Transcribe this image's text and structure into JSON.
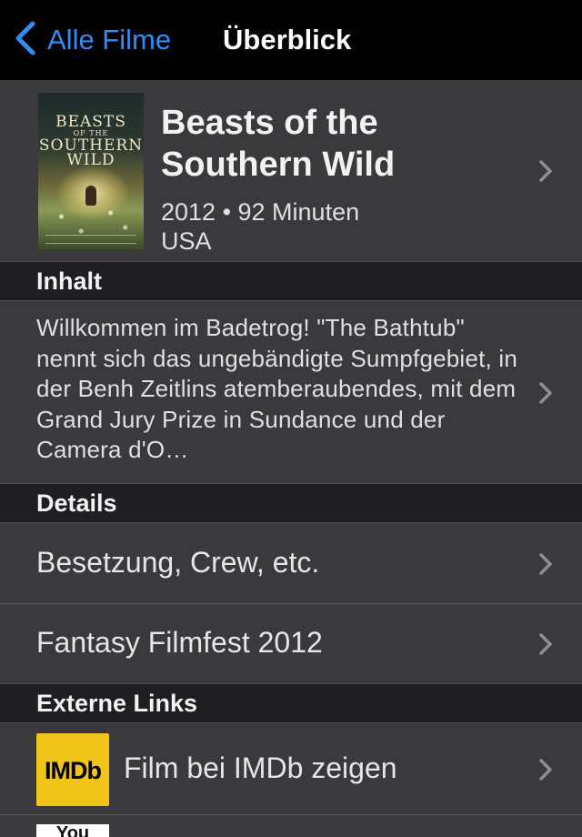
{
  "navbar": {
    "back_label": "Alle Filme",
    "title": "Überblick"
  },
  "movie": {
    "poster_title_line1": "BEASTS",
    "poster_title_small": "OF THE",
    "poster_title_line2": "SOUTHERN",
    "poster_title_line3": "WILD",
    "title": "Beasts of the Southern Wild",
    "year_runtime": "2012 • 92 Minuten",
    "country": "USA"
  },
  "sections": {
    "content": "Inhalt",
    "details": "Details",
    "external_links": "Externe Links"
  },
  "synopsis": "Willkommen im Badetrog! \"The Bathtub\" nennt sich das ungebändigte Sumpfgebiet, in der Benh Zeitlins atemberaubendes, mit dem Grand Jury Prize in Sundance und der Camera d'O…",
  "details_items": [
    {
      "label": "Besetzung, Crew, etc."
    },
    {
      "label": "Fantasy Filmfest 2012"
    }
  ],
  "links": {
    "imdb_logo_text": "IMDb",
    "imdb_label": "Film bei IMDb zeigen",
    "youtube_logo_text": "You"
  },
  "colors": {
    "accent": "#2f8df5",
    "background": "#3a3a3c",
    "section_header": "#1f1f21",
    "navbar": "#000000",
    "imdb": "#f0c419"
  },
  "icons": {
    "back": "chevron-left-icon",
    "disclosure": "chevron-right-icon"
  }
}
